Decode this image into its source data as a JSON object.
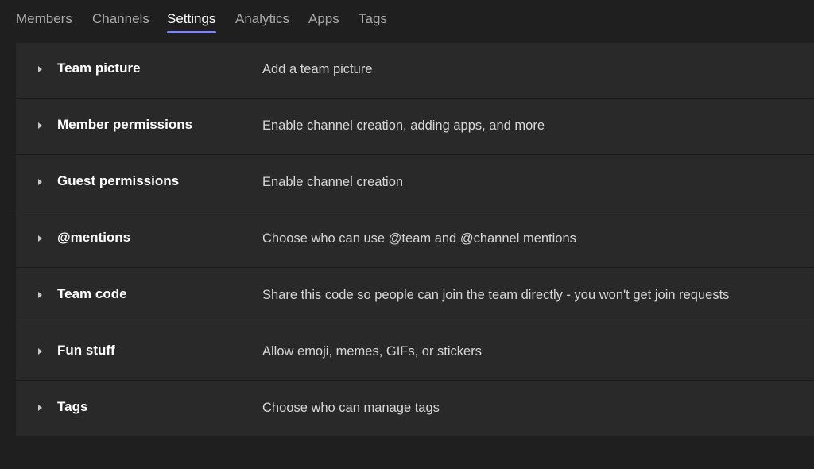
{
  "tabs": [
    {
      "label": "Members"
    },
    {
      "label": "Channels"
    },
    {
      "label": "Settings",
      "active": true
    },
    {
      "label": "Analytics"
    },
    {
      "label": "Apps"
    },
    {
      "label": "Tags"
    }
  ],
  "colors": {
    "background": "#1f1f1f",
    "panel": "#292929",
    "accent": "#7f85f5"
  },
  "settings": [
    {
      "title": "Team picture",
      "description": "Add a team picture",
      "icon": "chevron-right-icon"
    },
    {
      "title": "Member permissions",
      "description": "Enable channel creation, adding apps, and more",
      "icon": "chevron-right-icon"
    },
    {
      "title": "Guest permissions",
      "description": "Enable channel creation",
      "icon": "chevron-right-icon"
    },
    {
      "title": "@mentions",
      "description": "Choose who can use @team and @channel mentions",
      "icon": "chevron-right-icon"
    },
    {
      "title": "Team code",
      "description": "Share this code so people can join the team directly - you won't get join requests",
      "icon": "chevron-right-icon"
    },
    {
      "title": "Fun stuff",
      "description": "Allow emoji, memes, GIFs, or stickers",
      "icon": "chevron-right-icon"
    },
    {
      "title": "Tags",
      "description": "Choose who can manage tags",
      "icon": "chevron-right-icon"
    }
  ]
}
